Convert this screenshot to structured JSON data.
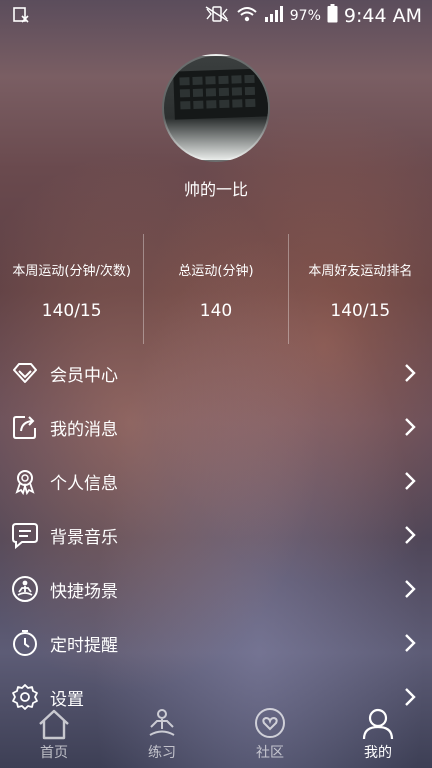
{
  "status_bar": {
    "battery": "97%",
    "time": "9:44 AM"
  },
  "profile": {
    "username": "帅的一比"
  },
  "stats": [
    {
      "label": "本周运动(分钟/次数)",
      "value": "140/15"
    },
    {
      "label": "总运动(分钟)",
      "value": "140"
    },
    {
      "label": "本周好友运动排名",
      "value": "140/15"
    }
  ],
  "menu": {
    "items": [
      {
        "label": "会员中心",
        "icon": "diamond-icon"
      },
      {
        "label": "我的消息",
        "icon": "share-message-icon"
      },
      {
        "label": "个人信息",
        "icon": "badge-icon"
      },
      {
        "label": "背景音乐",
        "icon": "chat-music-icon"
      },
      {
        "label": "快捷场景",
        "icon": "meditation-icon"
      },
      {
        "label": "定时提醒",
        "icon": "timer-icon"
      },
      {
        "label": "设置",
        "icon": "gear-icon"
      }
    ]
  },
  "tabs": [
    {
      "label": "首页",
      "icon": "home-icon",
      "active": false
    },
    {
      "label": "练习",
      "icon": "yoga-icon",
      "active": false
    },
    {
      "label": "社区",
      "icon": "heart-bubble-icon",
      "active": false
    },
    {
      "label": "我的",
      "icon": "user-icon",
      "active": true
    }
  ]
}
